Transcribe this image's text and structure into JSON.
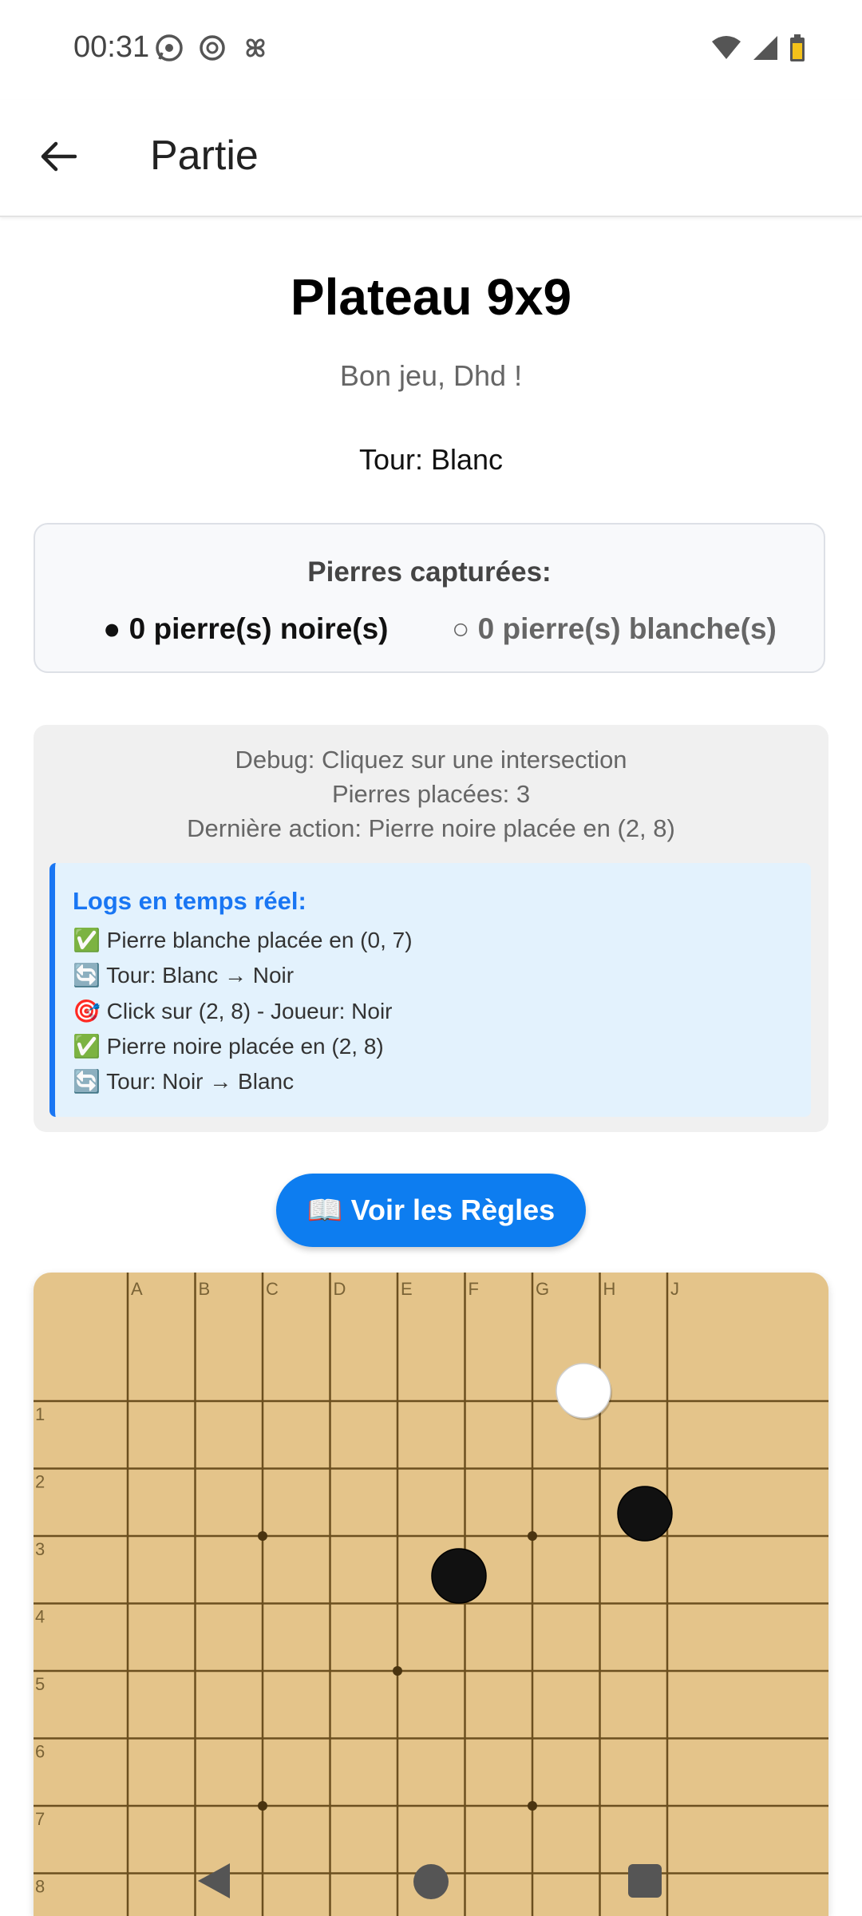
{
  "status_bar": {
    "time": "00:31",
    "left_icons": [
      "whatsapp-icon",
      "openai-icon",
      "pinwheel-icon"
    ],
    "right_icons": [
      "wifi-icon",
      "signal-icon",
      "battery-icon"
    ]
  },
  "app_bar": {
    "title": "Partie",
    "back_icon": "arrow-left-icon"
  },
  "game": {
    "title": "Plateau 9x9",
    "greeting": "Bon jeu, Dhd !",
    "turn": "Tour: Blanc"
  },
  "captures": {
    "title": "Pierres capturées:",
    "black": "● 0 pierre(s) noire(s)",
    "white": "○ 0 pierre(s) blanche(s)"
  },
  "debug": {
    "lines": [
      "Debug: Cliquez sur une intersection",
      "Pierres placées: 3",
      "Dernière action: Pierre noire placée en (2, 8)"
    ],
    "logs_title": "Logs en temps réel:",
    "logs": [
      "✅ Pierre blanche placée en (0, 7)",
      "🔄 Tour: Blanc → Noir",
      "🎯 Click sur (2, 8) - Joueur: Noir",
      "✅ Pierre noire placée en (2, 8)",
      "🔄 Tour: Noir → Blanc"
    ]
  },
  "rules_button": {
    "label": "📖 Voir les Règles"
  },
  "board": {
    "size": 9,
    "column_labels": [
      "A",
      "B",
      "C",
      "D",
      "E",
      "F",
      "G",
      "H",
      "J"
    ],
    "row_labels": [
      "1",
      "2",
      "3",
      "4",
      "5",
      "6",
      "7",
      "8"
    ],
    "stones": [
      {
        "color": "white",
        "col": 7,
        "row": 0
      },
      {
        "color": "black",
        "col": 8,
        "row": 2
      },
      {
        "color": "black",
        "col": 5,
        "row": 3
      }
    ],
    "hoshi": [
      {
        "col": 2,
        "row": 2
      },
      {
        "col": 6,
        "row": 2
      },
      {
        "col": 4,
        "row": 4
      },
      {
        "col": 2,
        "row": 6
      },
      {
        "col": 6,
        "row": 6
      }
    ],
    "colors": {
      "wood": "#e4c48a",
      "line": "#6b4f1f"
    }
  },
  "nav_bar": {
    "icons": [
      "back-triangle-icon",
      "home-circle-icon",
      "recents-square-icon"
    ]
  }
}
